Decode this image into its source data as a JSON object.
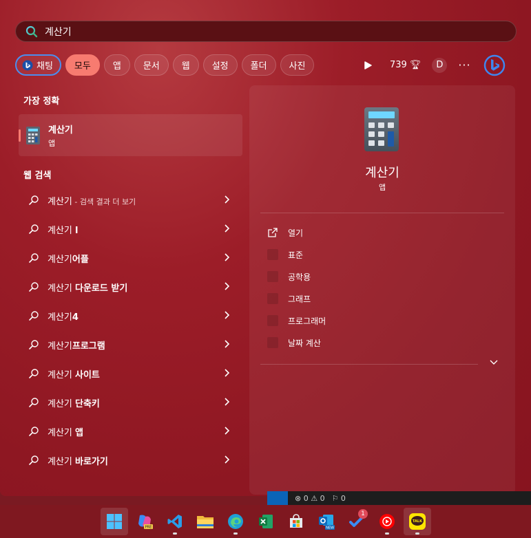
{
  "search": {
    "value": "계산기"
  },
  "filters": {
    "chat": "채팅",
    "chips": [
      "모두",
      "앱",
      "문서",
      "웹",
      "설정",
      "폴더",
      "사진"
    ],
    "points": "739",
    "avatar": "D",
    "more": "···"
  },
  "best_match": {
    "heading": "가장 정확",
    "title": "계산기",
    "subtitle": "앱"
  },
  "web_search": {
    "heading": "웹 검색",
    "results": [
      {
        "query": "계산기",
        "bold": "",
        "suffix": " - 검색 결과 더 보기"
      },
      {
        "query": "계산기 ",
        "bold": "l",
        "suffix": ""
      },
      {
        "query": "계산기",
        "bold": "어플",
        "suffix": ""
      },
      {
        "query": "계산기 ",
        "bold": "다운로드 받기",
        "suffix": ""
      },
      {
        "query": "계산기",
        "bold": "4",
        "suffix": ""
      },
      {
        "query": "계산기",
        "bold": "프로그램",
        "suffix": ""
      },
      {
        "query": "계산기 ",
        "bold": "사이트",
        "suffix": ""
      },
      {
        "query": "계산기 ",
        "bold": "단축키",
        "suffix": ""
      },
      {
        "query": "계산기 ",
        "bold": "앱",
        "suffix": ""
      },
      {
        "query": "계산기 ",
        "bold": "바로가기",
        "suffix": ""
      }
    ]
  },
  "detail": {
    "title": "계산기",
    "subtitle": "앱",
    "actions": [
      "열기",
      "표준",
      "공학용",
      "그래프",
      "프로그래머",
      "날짜 계산"
    ]
  },
  "status_strip": {
    "errors": "⊗ 0 ⚠ 0",
    "ports": "⚐ 0"
  },
  "taskbar": {
    "icons": [
      "start-icon",
      "copilot-pre-icon",
      "vscode-icon",
      "file-explorer-icon",
      "edge-icon",
      "excel-icon",
      "microsoft-store-icon",
      "outlook-new-icon",
      "todo-icon",
      "youtube-music-icon",
      "kakaotalk-icon"
    ],
    "todo_badge": "1"
  },
  "colors": {
    "accent": "#f77b70",
    "bing_blue": "#4a8ef0",
    "panel": "#9c1d28"
  }
}
